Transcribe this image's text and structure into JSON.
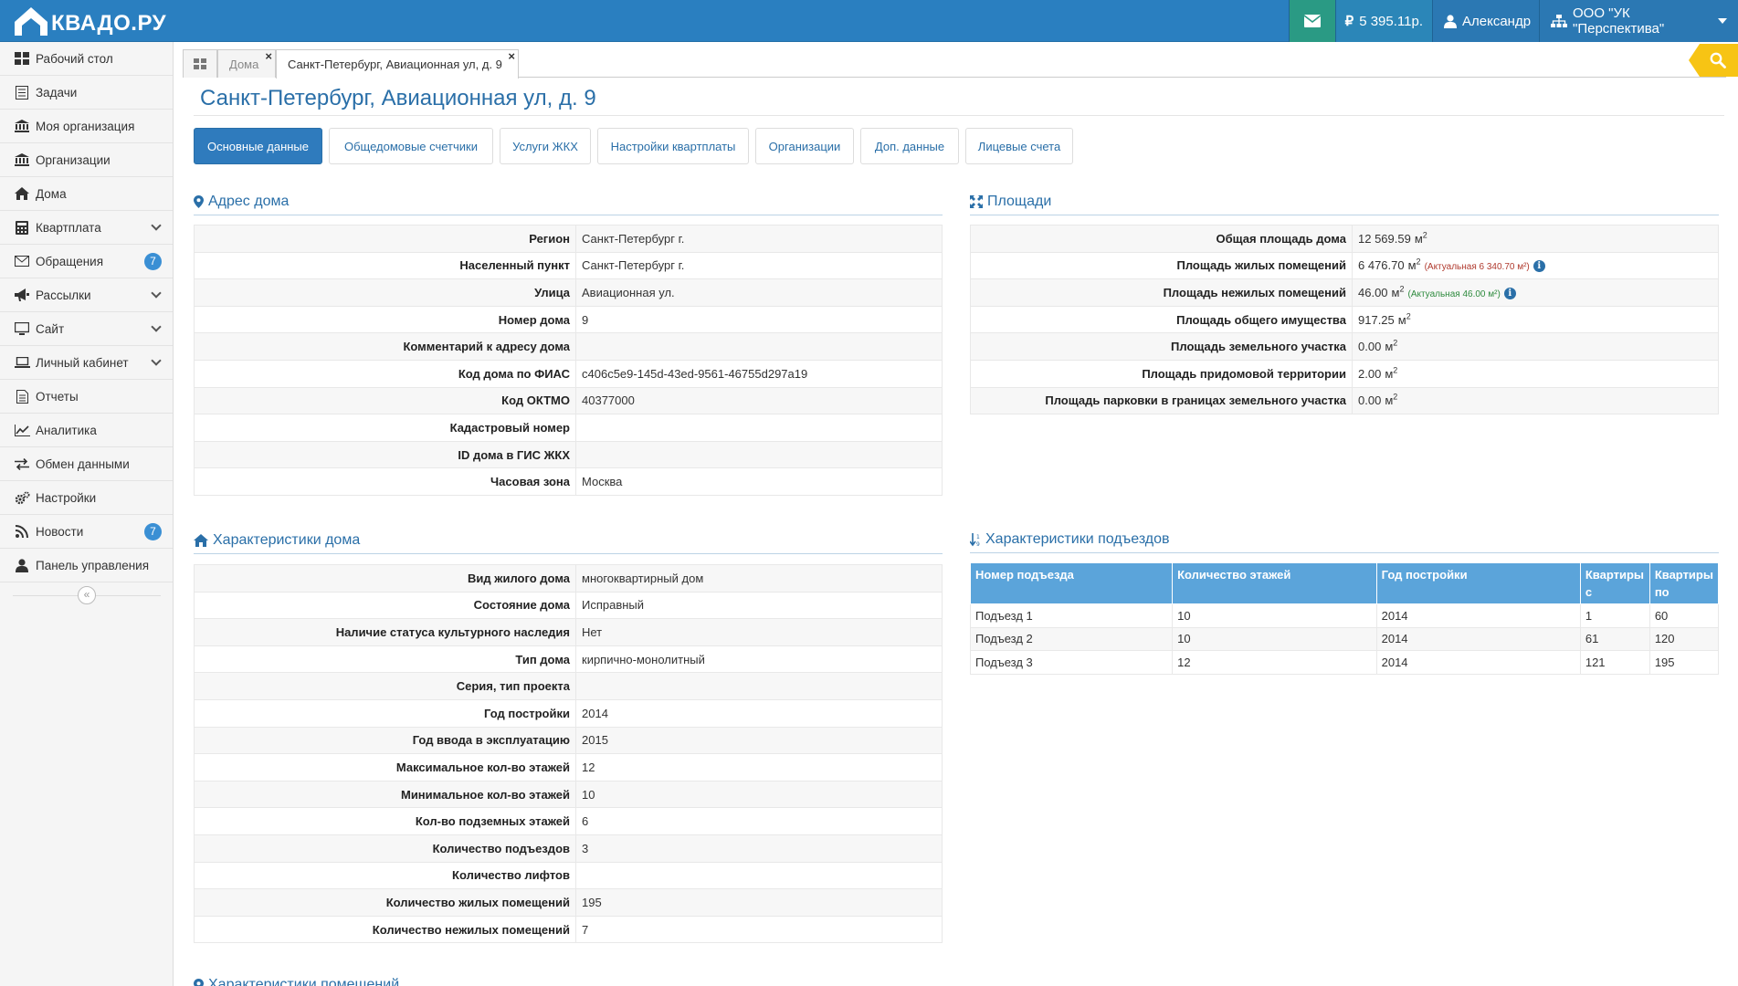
{
  "app": {
    "logo_text": "КВАДО.РУ"
  },
  "topnav": {
    "balance": "5 395.11р.",
    "user": "Александр",
    "org": "ООО \"УК \"Перспектива\""
  },
  "sidebar": {
    "items": [
      {
        "label": "Рабочий стол",
        "icon": "desktop-grid-icon"
      },
      {
        "label": "Задачи",
        "icon": "task-list-icon"
      },
      {
        "label": "Моя организация",
        "icon": "institution-icon"
      },
      {
        "label": "Организации",
        "icon": "institution-icon"
      },
      {
        "label": "Дома",
        "icon": "home-icon"
      },
      {
        "label": "Квартплата",
        "icon": "calculator-icon",
        "expandable": true
      },
      {
        "label": "Обращения",
        "icon": "envelope-icon",
        "badge": "7"
      },
      {
        "label": "Рассылки",
        "icon": "bullhorn-icon",
        "expandable": true
      },
      {
        "label": "Сайт",
        "icon": "monitor-icon",
        "expandable": true
      },
      {
        "label": "Личный кабинет",
        "icon": "laptop-icon",
        "expandable": true
      },
      {
        "label": "Отчеты",
        "icon": "document-icon"
      },
      {
        "label": "Аналитика",
        "icon": "line-chart-icon"
      },
      {
        "label": "Обмен данными",
        "icon": "exchange-icon"
      },
      {
        "label": "Настройки",
        "icon": "gears-icon"
      },
      {
        "label": "Новости",
        "icon": "rss-icon",
        "badge": "7"
      },
      {
        "label": "Панель управления",
        "icon": "user-icon"
      }
    ],
    "collapse": "«"
  },
  "tabs": {
    "home_tab": "Дома",
    "active_tab": "Санкт-Петербург, Авиационная ул, д. 9",
    "close": "×"
  },
  "page": {
    "title": "Санкт-Петербург, Авиационная ул, д. 9",
    "buttons": [
      "Основные данные",
      "Общедомовые счетчики",
      "Услуги ЖКХ",
      "Настройки квартплаты",
      "Организации",
      "Доп. данные",
      "Лицевые счета"
    ]
  },
  "address": {
    "title": "Адрес дома",
    "rows": [
      {
        "k": "Регион",
        "v": "Санкт-Петербург г."
      },
      {
        "k": "Населенный пункт",
        "v": "Санкт-Петербург г."
      },
      {
        "k": "Улица",
        "v": "Авиационная ул."
      },
      {
        "k": "Номер дома",
        "v": "9"
      },
      {
        "k": "Комментарий к адресу дома",
        "v": ""
      },
      {
        "k": "Код дома по ФИАС",
        "v": "c406c5e9-145d-43ed-9561-46755d297a19"
      },
      {
        "k": "Код ОКТМО",
        "v": "40377000"
      },
      {
        "k": "Кадастровый номер",
        "v": ""
      },
      {
        "k": "ID дома в ГИС ЖКХ",
        "v": ""
      },
      {
        "k": "Часовая зона",
        "v": "Москва"
      }
    ]
  },
  "areas": {
    "title": "Площади",
    "unit": "м",
    "unit_sup": "2",
    "rows": [
      {
        "k": "Общая площадь дома",
        "v": "12 569.59"
      },
      {
        "k": "Площадь жилых помещений",
        "v": "6 476.70",
        "note": "(Актуальная 6 340.70 м²)",
        "note_color": "red"
      },
      {
        "k": "Площадь нежилых помещений",
        "v": "46.00",
        "note": "(Актуальная 46.00 м²)",
        "note_color": "green"
      },
      {
        "k": "Площадь общего имущества",
        "v": "917.25"
      },
      {
        "k": "Площадь земельного участка",
        "v": "0.00"
      },
      {
        "k": "Площадь придомовой территории",
        "v": "2.00"
      },
      {
        "k": "Площадь парковки в границах земельного участка",
        "v": "0.00"
      }
    ]
  },
  "house": {
    "title": "Характеристики дома",
    "rows": [
      {
        "k": "Вид жилого дома",
        "v": "многоквартирный дом"
      },
      {
        "k": "Состояние дома",
        "v": "Исправный"
      },
      {
        "k": "Наличие статуса культурного наследия",
        "v": "Нет"
      },
      {
        "k": "Тип дома",
        "v": "кирпично-монолитный"
      },
      {
        "k": "Серия, тип проекта",
        "v": ""
      },
      {
        "k": "Год постройки",
        "v": "2014"
      },
      {
        "k": "Год ввода в эксплуатацию",
        "v": "2015"
      },
      {
        "k": "Максимальное кол-во этажей",
        "v": "12"
      },
      {
        "k": "Минимальное кол-во этажей",
        "v": "10"
      },
      {
        "k": "Кол-во подземных этажей",
        "v": "6"
      },
      {
        "k": "Количество подъездов",
        "v": "3"
      },
      {
        "k": "Количество лифтов",
        "v": ""
      },
      {
        "k": "Количество жилых помещений",
        "v": "195"
      },
      {
        "k": "Количество нежилых помещений",
        "v": "7"
      }
    ]
  },
  "entrances": {
    "title": "Характеристики подъездов",
    "headers": [
      "Номер подъезда",
      "Количество этажей",
      "Год постройки",
      "Квартиры с",
      "Квартиры по"
    ],
    "rows": [
      [
        "Подъезд 1",
        "10",
        "2014",
        "1",
        "60"
      ],
      [
        "Подъезд 2",
        "10",
        "2014",
        "61",
        "120"
      ],
      [
        "Подъезд 3",
        "12",
        "2014",
        "121",
        "195"
      ]
    ]
  },
  "next_section": {
    "title": "Характеристики помещений"
  }
}
